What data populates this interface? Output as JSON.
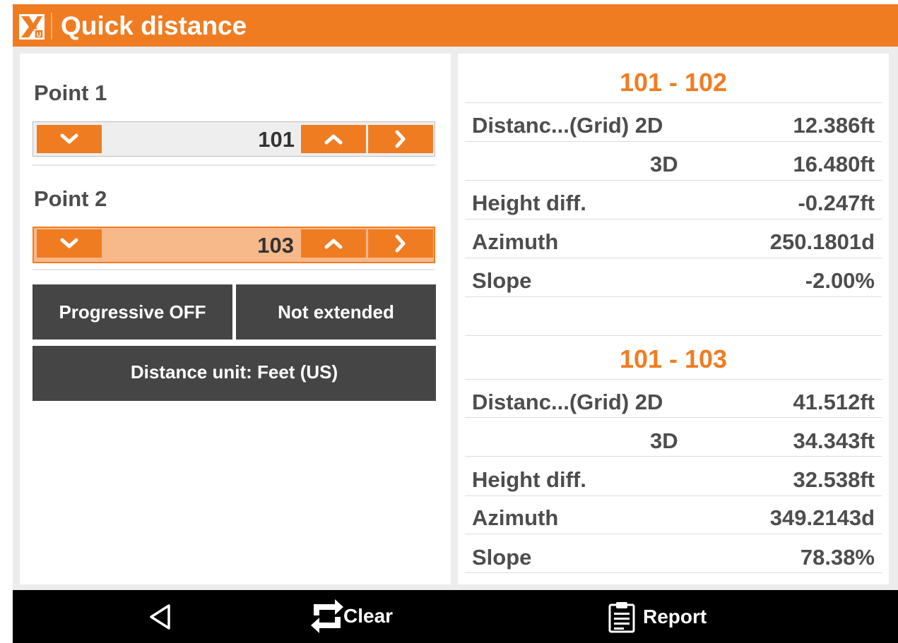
{
  "app": {
    "title": "Quick distance"
  },
  "colors": {
    "accent": "#f07c22",
    "active_field": "#f7b88a",
    "dark_button": "#454545"
  },
  "left": {
    "point1": {
      "label": "Point 1",
      "value": "101"
    },
    "point2": {
      "label": "Point 2",
      "value": "103"
    },
    "progressive_label": "Progressive OFF",
    "extended_label": "Not extended",
    "unit_label": "Distance unit: Feet (US)"
  },
  "results": [
    {
      "title": "101 - 102",
      "rows": [
        {
          "label": "Distanc...(Grid) 2D",
          "value": "12.386ft"
        },
        {
          "label": "3D",
          "value": "16.480ft"
        },
        {
          "label": "Height diff.",
          "value": "-0.247ft"
        },
        {
          "label": "Azimuth",
          "value": "250.1801d"
        },
        {
          "label": "Slope",
          "value": "-2.00%"
        }
      ]
    },
    {
      "title": "101 - 103",
      "rows": [
        {
          "label": "Distanc...(Grid) 2D",
          "value": "41.512ft"
        },
        {
          "label": "3D",
          "value": "34.343ft"
        },
        {
          "label": "Height diff.",
          "value": "32.538ft"
        },
        {
          "label": "Azimuth",
          "value": "349.2143d"
        },
        {
          "label": "Slope",
          "value": "78.38%"
        }
      ]
    }
  ],
  "navbar": {
    "back_icon": "back-triangle-icon",
    "clear_label": "Clear",
    "report_label": "Report"
  }
}
